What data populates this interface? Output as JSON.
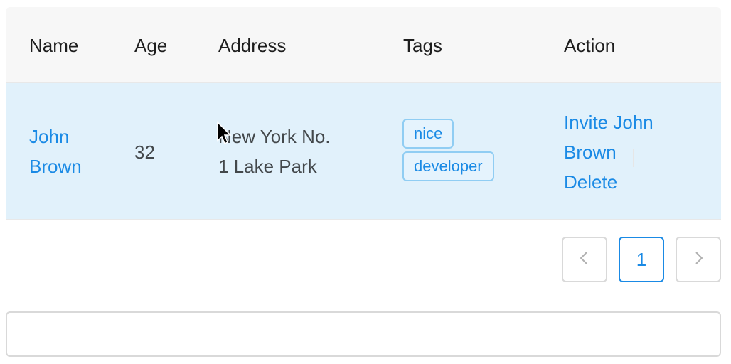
{
  "table": {
    "columns": [
      "Name",
      "Age",
      "Address",
      "Tags",
      "Action"
    ],
    "rows": [
      {
        "name_line1": "John",
        "name_line2": "Brown",
        "age": "32",
        "address_line1": "New York No.",
        "address_line2": "1 Lake Park",
        "tags": [
          "nice",
          "developer"
        ],
        "action_invite_line1": "Invite John",
        "action_invite_line2": "Brown",
        "action_delete": "Delete"
      }
    ]
  },
  "pagination": {
    "current_page": "1",
    "prev_icon": "chevron-left-icon",
    "next_icon": "chevron-right-icon"
  },
  "colors": {
    "accent": "#1a8ae5",
    "row_highlight": "#e1f1fb",
    "header_bg": "#f7f7f7"
  }
}
